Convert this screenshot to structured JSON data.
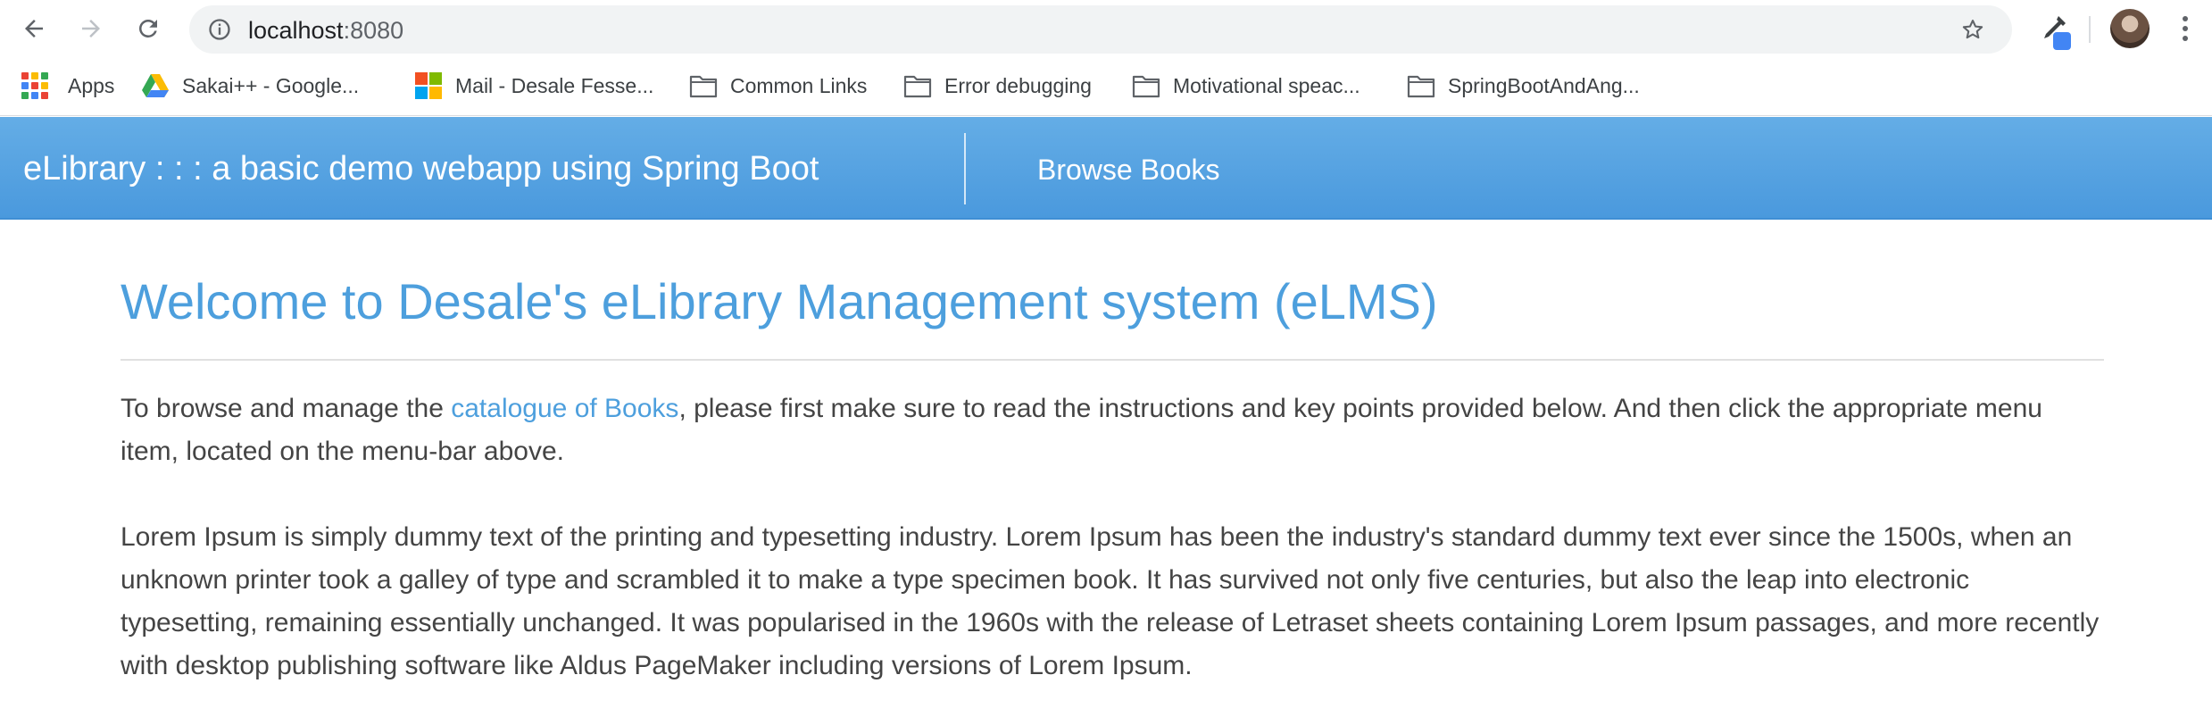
{
  "browser": {
    "url_host": "localhost",
    "url_port": ":8080",
    "icons": {
      "back": "arrow-left-icon",
      "forward": "arrow-right-icon",
      "reload": "reload-icon",
      "info": "info-icon",
      "bookmark": "star-icon",
      "extension": "eyedropper-icon",
      "menu": "kebab-icon"
    }
  },
  "bookmarks": {
    "items": [
      {
        "label": "Apps",
        "icon": "apps-grid-icon"
      },
      {
        "label": "Sakai++ - Google...",
        "icon": "google-drive-icon"
      },
      {
        "label": "Mail - Desale Fesse...",
        "icon": "microsoft-icon"
      },
      {
        "label": "Common Links",
        "icon": "folder-icon"
      },
      {
        "label": "Error debugging",
        "icon": "folder-icon"
      },
      {
        "label": "Motivational speac...",
        "icon": "folder-icon"
      },
      {
        "label": "SpringBootAndAng...",
        "icon": "folder-icon"
      }
    ]
  },
  "navbar": {
    "brand": "eLibrary : : : a basic demo webapp using Spring Boot",
    "link_browse": "Browse Books",
    "colors": {
      "bg_top": "#64ade6",
      "bg_bottom": "#4a99dd"
    }
  },
  "main": {
    "title": "Welcome to Desale's eLibrary Management system (eLMS)",
    "intro_before": "To browse and manage the ",
    "intro_link": "catalogue of Books",
    "intro_after": ", please first make sure to read the instructions and key points provided below. And then click the appropriate menu item, located on the menu-bar above.",
    "lorem": "Lorem Ipsum is simply dummy text of the printing and typesetting industry. Lorem Ipsum has been the industry's standard dummy text ever since the 1500s, when an unknown printer took a galley of type and scrambled it to make a type specimen book. It has survived not only five centuries, but also the leap into electronic typesetting, remaining essentially unchanged. It was popularised in the 1960s with the release of Letraset sheets containing Lorem Ipsum passages, and more recently with desktop publishing software like Aldus PageMaker including versions of Lorem Ipsum.",
    "colors": {
      "accent": "#4d9fdd",
      "text": "#444444"
    }
  }
}
